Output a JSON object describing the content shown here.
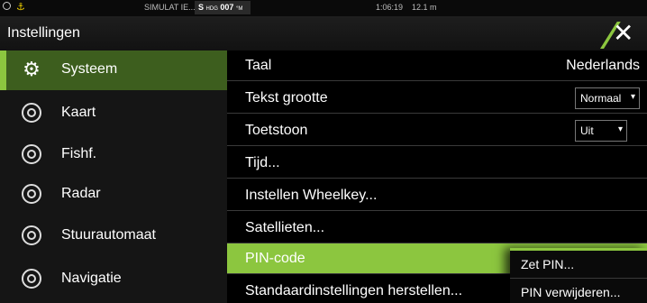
{
  "status_bar": {
    "simulation": "SIMULAT IE...",
    "heading_prefix": "S",
    "heading_label": "HDG",
    "heading_value": "007",
    "heading_unit": "°M",
    "time": "1:06:19",
    "depth": "12.1 m"
  },
  "titlebar": {
    "title": "Instellingen",
    "close_icon": "close-icon"
  },
  "colors": {
    "accent": "#8cc63f",
    "active_sidebar": "#3d5e1e",
    "background": "#000000"
  },
  "sidebar": {
    "items": [
      {
        "label": "Systeem",
        "icon": "gear-icon",
        "active": true
      },
      {
        "label": "Kaart",
        "icon": "chart-globe-icon",
        "active": false
      },
      {
        "label": "Fishf.",
        "icon": "fish-finder-icon",
        "active": false
      },
      {
        "label": "Radar",
        "icon": "radar-icon",
        "active": false
      },
      {
        "label": "Stuurautomaat",
        "icon": "autopilot-wheel-icon",
        "active": false
      },
      {
        "label": "Navigatie",
        "icon": "navigation-compass-icon",
        "active": false
      }
    ]
  },
  "settings": {
    "rows": [
      {
        "label": "Taal",
        "value": "Nederlands"
      },
      {
        "label": "Tekst grootte",
        "dropdown": "Normaal"
      },
      {
        "label": "Toetstoon",
        "dropdown": "Uit"
      },
      {
        "label": "Tijd..."
      },
      {
        "label": "Instellen Wheelkey..."
      },
      {
        "label": "Satellieten..."
      },
      {
        "label": "PIN-code",
        "selected": true
      },
      {
        "label": "Standaardinstellingen herstellen..."
      }
    ]
  },
  "popup": {
    "items": [
      {
        "label": "Zet PIN..."
      },
      {
        "label": "PIN verwijderen..."
      }
    ]
  }
}
